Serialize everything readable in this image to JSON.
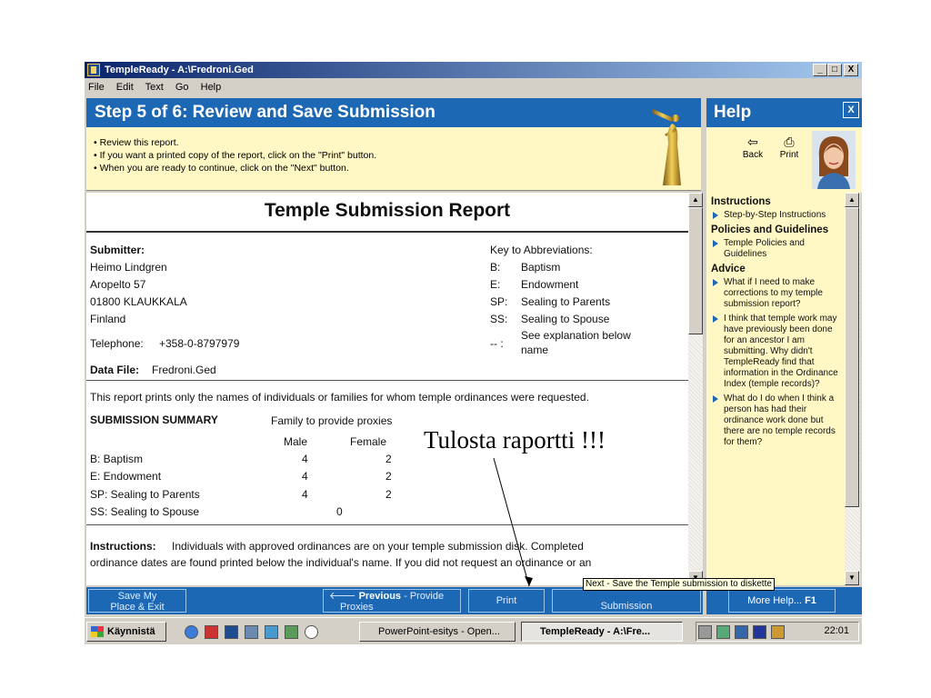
{
  "window": {
    "title": "TempleReady - A:\\Fredroni.Ged",
    "controls": [
      "_",
      "□",
      "X"
    ]
  },
  "menu": [
    "File",
    "Edit",
    "Text",
    "Go",
    "Help"
  ],
  "step": {
    "title": "Step 5 of 6: Review and Save Submission",
    "instructions": [
      "• Review this report.",
      "• If you want a printed copy of the report, click on the \"Print\" button.",
      "• When you are ready to continue, click on the \"Next\" button."
    ]
  },
  "report": {
    "title": "Temple Submission Report",
    "submitter_label": "Submitter:",
    "submitter_lines": [
      "Heimo Lindgren",
      "Aropelto 57",
      "01800 KLAUKKALA",
      "Finland"
    ],
    "telephone_label": "Telephone:",
    "telephone": "+358-0-8797979",
    "data_file_label": "Data File:",
    "data_file": "Fredroni.Ged",
    "key_title": "Key to Abbreviations:",
    "key": [
      {
        "code": "B:",
        "meaning": "Baptism"
      },
      {
        "code": "E:",
        "meaning": "Endowment"
      },
      {
        "code": "SP:",
        "meaning": "Sealing to Parents"
      },
      {
        "code": "SS:",
        "meaning": "Sealing to Spouse"
      },
      {
        "code": "-- :",
        "meaning": "See explanation below"
      },
      {
        "code": "",
        "meaning": "name"
      }
    ],
    "note": "This report prints only the names of individuals or families for whom temple ordinances were requested.",
    "summary": {
      "title": "SUBMISSION SUMMARY",
      "family_header": "Family to provide proxies",
      "col_male": "Male",
      "col_female": "Female",
      "rows": [
        {
          "label": "B: Baptism",
          "male": "4",
          "female": "2"
        },
        {
          "label": "E: Endowment",
          "male": "4",
          "female": "2"
        },
        {
          "label": "SP: Sealing to Parents",
          "male": "4",
          "female": "2"
        },
        {
          "label": "SS: Sealing to Spouse",
          "value": "0"
        }
      ]
    },
    "instructions_label": "Instructions:",
    "instructions_line1": "Individuals with approved ordinances are on your temple submission disk.  Completed",
    "instructions_line2": "ordinance dates are found printed below the individual's name.  If you did not request an ordinance or an"
  },
  "nav": {
    "save": [
      "Save My",
      "Place & Exit"
    ],
    "previous_bold": "Previous",
    "previous_rest": "- Provide",
    "previous_line2": "Proxies",
    "print": "Print",
    "next_line2": "Submission",
    "more_help": "More Help...",
    "more_help_key": "F1"
  },
  "tooltip": "Next - Save the Temple submission to diskette",
  "help": {
    "title": "Help",
    "close": "X",
    "back": "Back",
    "print": "Print",
    "sections": [
      {
        "title": "Instructions",
        "items": [
          "Step-by-Step Instructions"
        ]
      },
      {
        "title": "Policies and Guidelines",
        "items": [
          "Temple Policies and Guidelines"
        ]
      },
      {
        "title": "Advice",
        "items": [
          "What if I need to make corrections to my temple submission report?",
          "I think that temple work may have previously been done for an ancestor I am submitting. Why didn't TempleReady find that information in the Ordinance Index (temple records)?",
          "What do I do when I think a person has had their ordinance work done but there are no temple records for them?"
        ]
      }
    ]
  },
  "taskbar": {
    "start": "Käynnistä",
    "tasks": [
      "PowerPoint-esitys - Open...",
      "TempleReady - A:\\Fre..."
    ],
    "clock": "22:01"
  },
  "annotation": "Tulosta raportti !!!"
}
